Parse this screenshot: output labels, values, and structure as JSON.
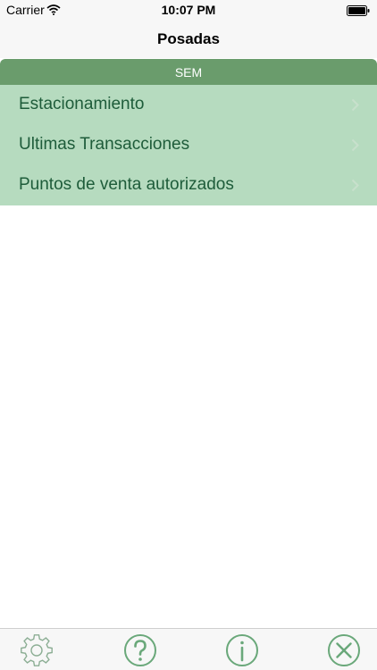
{
  "status_bar": {
    "carrier": "Carrier",
    "time": "10:07 PM"
  },
  "nav": {
    "title": "Posadas"
  },
  "section": {
    "header": "SEM"
  },
  "menu": {
    "items": [
      {
        "label": "Estacionamiento"
      },
      {
        "label": "Ultimas Transacciones"
      },
      {
        "label": "Puntos de venta autorizados"
      }
    ]
  },
  "tab_bar": {
    "icons": [
      "gear-icon",
      "help-icon",
      "info-icon",
      "close-icon"
    ]
  },
  "colors": {
    "header_green": "#6a9c6c",
    "list_green": "#b6dbbf",
    "text_green": "#1e5c3a",
    "icon_green": "#6aa87a"
  }
}
